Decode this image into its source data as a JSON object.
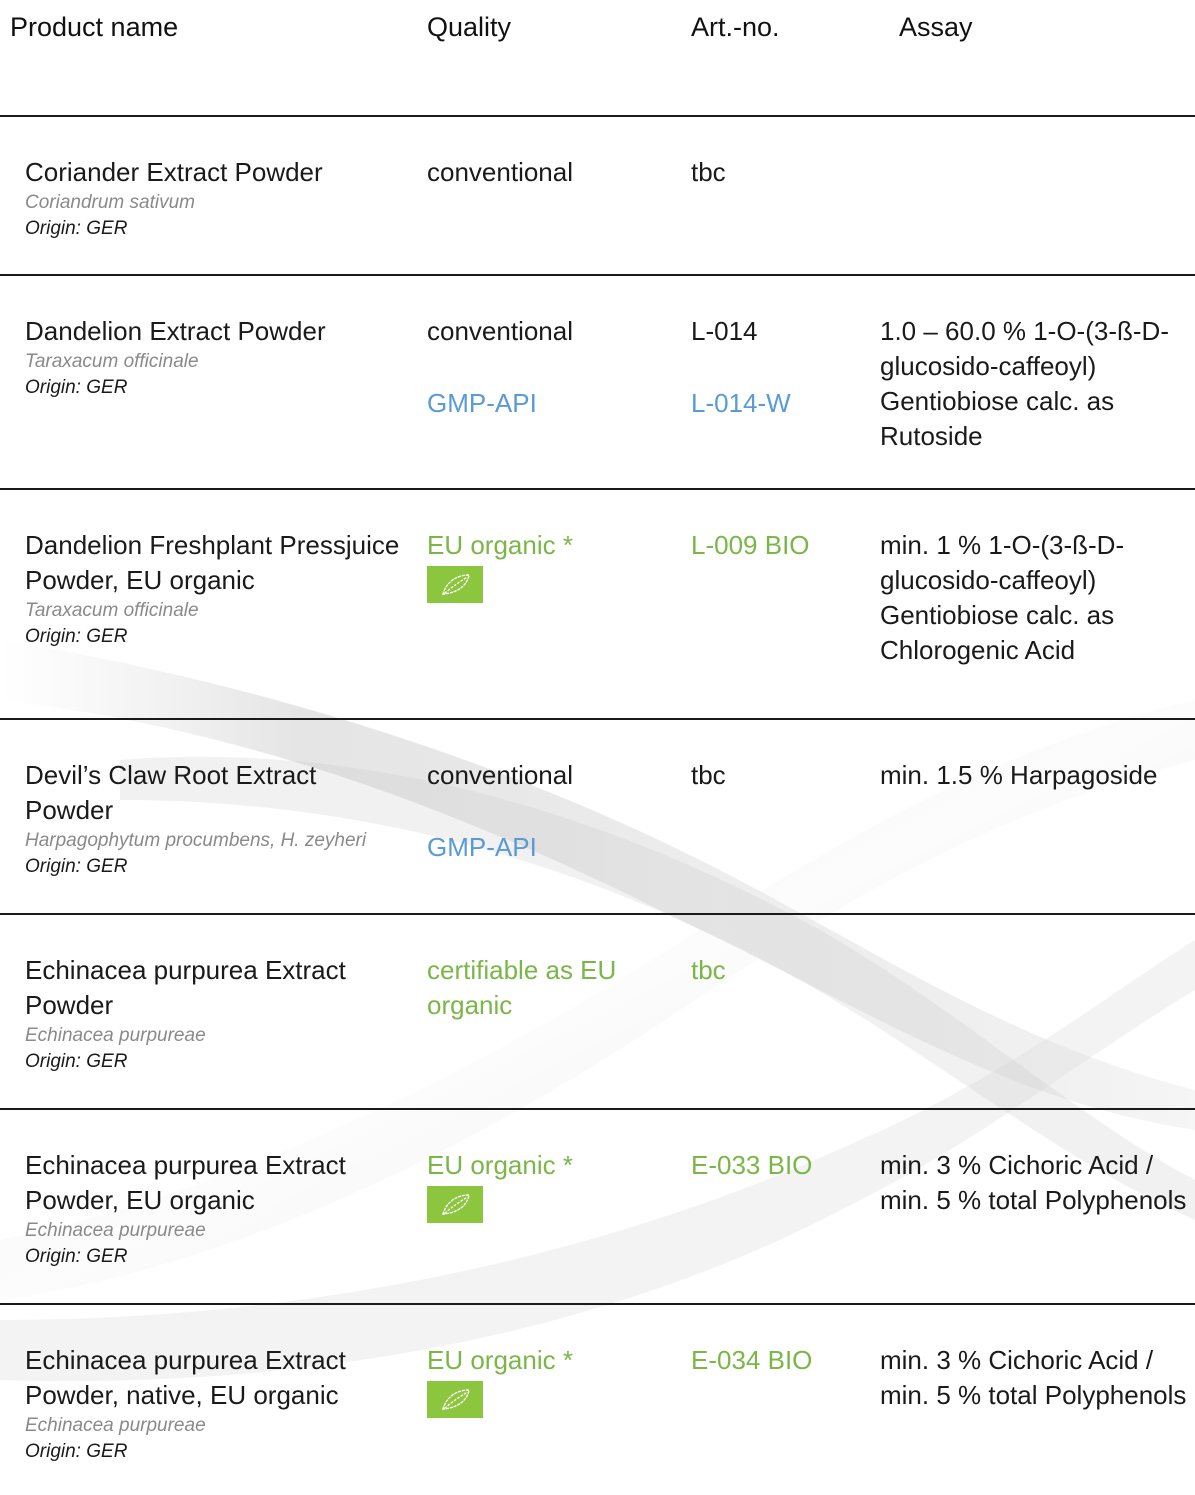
{
  "header": {
    "product_name": "Product name",
    "quality": "Quality",
    "art_no": "Art.-no.",
    "assay": "Assay"
  },
  "colors": {
    "organic_green": "#7ab648",
    "gmp_blue": "#5b9bd5",
    "latin_grey": "#8a8a8a",
    "eu_logo_green": "#8cc63f"
  },
  "rows": [
    {
      "name": "Coriander Extract Powder",
      "latin": "Coriandrum sativum",
      "origin": "Origin: GER",
      "quality": [
        "conventional"
      ],
      "art": [
        "tbc"
      ],
      "assay": ""
    },
    {
      "name": "Dandelion Extract Powder",
      "latin": "Taraxacum officinale",
      "origin": "Origin: GER",
      "quality": [
        "conventional",
        "GMP-API"
      ],
      "art": [
        "L-014",
        "L-014-W"
      ],
      "assay": "1.0 – 60.0 % 1-O-(3-ß-D-glucosido-caffeoyl) Gentiobiose calc. as Rutoside"
    },
    {
      "name": "Dandelion Freshplant Pressjuice Powder, EU organic",
      "latin": "Taraxacum officinale",
      "origin": "Origin: GER",
      "quality": [
        "EU organic *"
      ],
      "eu_logo": "eu-organic-leaf-icon",
      "art": [
        "L-009 BIO"
      ],
      "assay": "min. 1 % 1-O-(3-ß-D-glucosido-caffeoyl) Gentiobiose calc. as Chlorogenic Acid"
    },
    {
      "name": "Devil’s Claw Root Extract Powder",
      "latin": "Harpagophytum procumbens, H. zeyheri",
      "origin": "Origin: GER",
      "quality": [
        "conventional",
        "GMP-API"
      ],
      "art": [
        "tbc"
      ],
      "assay": "min. 1.5 % Harpagoside"
    },
    {
      "name": "Echinacea purpurea Extract Powder",
      "latin": "Echinacea purpureae",
      "origin": "Origin: GER",
      "quality": [
        "certifiable as EU organic"
      ],
      "art": [
        "tbc"
      ],
      "assay": ""
    },
    {
      "name": "Echinacea purpurea Extract Powder, EU organic",
      "latin": "Echinacea purpureae",
      "origin": "Origin: GER",
      "quality": [
        "EU organic *"
      ],
      "eu_logo": "eu-organic-leaf-icon",
      "art": [
        "E-033 BIO"
      ],
      "assay": "min. 3 % Cichoric Acid / min. 5 % total Polyphenols"
    },
    {
      "name": "Echinacea purpurea Extract Powder, native, EU organic",
      "latin": "Echinacea purpureae",
      "origin": "Origin: GER",
      "quality": [
        "EU organic *"
      ],
      "eu_logo": "eu-organic-leaf-icon",
      "art": [
        "E-034 BIO"
      ],
      "assay": "min. 3 % Cichoric Acid / min. 5 % total Polyphenols"
    }
  ]
}
